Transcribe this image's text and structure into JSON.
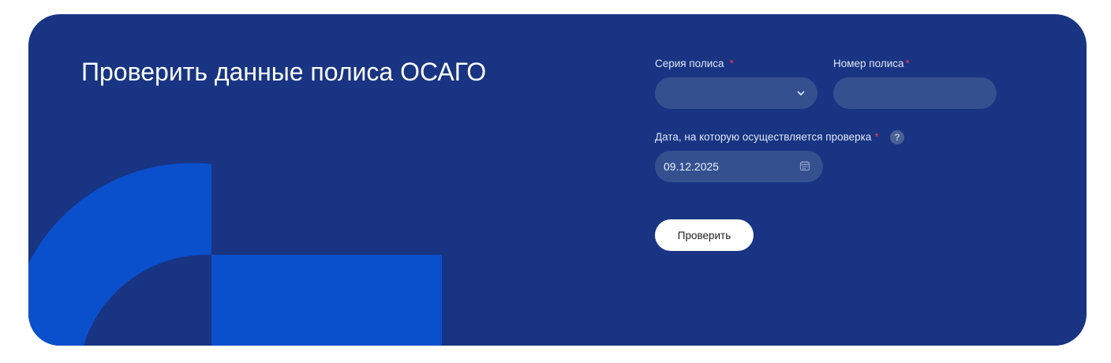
{
  "title": "Проверить данные полиса ОСАГО",
  "form": {
    "series": {
      "label": "Серия полиса",
      "required_mark": "*",
      "value": ""
    },
    "number": {
      "label": "Номер полиса",
      "required_mark": "*",
      "value": ""
    },
    "date": {
      "label": "Дата, на которую осуществляется проверка",
      "required_mark": "*",
      "value": "09.12.2025",
      "help_glyph": "?"
    },
    "submit_label": "Проверить"
  },
  "icons": {
    "series_dropdown": "chevron-down-icon",
    "date_picker": "calendar-icon",
    "date_help": "question-icon"
  },
  "colors": {
    "card_background": "#183482",
    "decor_blue": "#0a50cc",
    "input_background": "#34508f",
    "required": "#ef3a4d",
    "button_background": "#ffffff"
  }
}
